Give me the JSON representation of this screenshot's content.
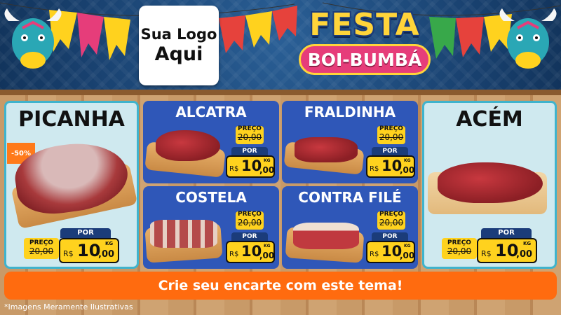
{
  "logo": {
    "line1": "Sua Logo",
    "line2": "Aqui"
  },
  "title": {
    "line1": "FESTA",
    "line2": "BOI-BUMBÁ"
  },
  "labels": {
    "preco": "PREÇO",
    "por": "POR",
    "currency": "R$",
    "unit": "KG"
  },
  "products": [
    {
      "name": "PICANHA",
      "old_price": "20,00",
      "price_int": "10",
      "price_dec": ",00",
      "discount": "-50%"
    },
    {
      "name": "ALCATRA",
      "old_price": "20,00",
      "price_int": "10",
      "price_dec": ",00"
    },
    {
      "name": "FRALDINHA",
      "old_price": "20,00",
      "price_int": "10",
      "price_dec": ",00"
    },
    {
      "name": "COSTELA",
      "old_price": "20,00",
      "price_int": "10",
      "price_dec": ",00"
    },
    {
      "name": "CONTRA FILÉ",
      "old_price": "20,00",
      "price_int": "10",
      "price_dec": ",00"
    },
    {
      "name": "ACÉM",
      "old_price": "20,00",
      "price_int": "10",
      "price_dec": ",00"
    }
  ],
  "cta": "Crie seu encarte com este tema!",
  "disclaimer": "*Imagens Meramente Ilustrativas"
}
